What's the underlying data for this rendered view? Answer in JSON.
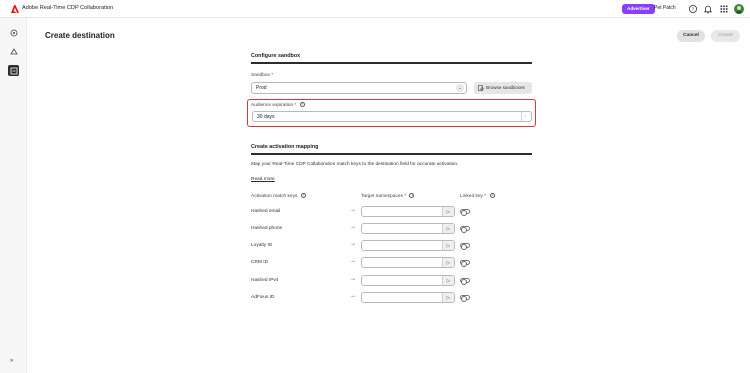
{
  "header": {
    "app_title": "Adobe Real-Time CDP Collaboration",
    "role_badge": "Advertiser",
    "org_name": "Pet Patch",
    "icons": [
      "help-icon",
      "bell-icon",
      "apps-grid-icon"
    ],
    "brand_color": "#eb1000",
    "badge_color": "#8a3ffc"
  },
  "rail": {
    "items": [
      "home-icon",
      "audiences-icon",
      "destinations-icon"
    ],
    "collapse_icon": "expand-chevrons-icon"
  },
  "page": {
    "title": "Create destination",
    "cancel_label": "Cancel",
    "create_label": "Create"
  },
  "sandbox_section": {
    "title": "Configure sandbox",
    "sandbox_label": "Sandbox",
    "required_mark": "*",
    "sandbox_value": "Prod",
    "browse_label": "Browse sandboxes",
    "expiration_label": "Audience expiration",
    "expiration_value": "30 days",
    "highlight_color": "#d7373f"
  },
  "mapping_section": {
    "title": "Create activation mapping",
    "description": "Map your Real-Time CDP Collaboration match keys to the destination field for accurate activation.",
    "read_more": "Read more",
    "col_match_keys": "Activation match keys",
    "col_namespaces": "Target namespaces",
    "col_linked_key": "Linked key",
    "required_mark": "*",
    "rows": [
      {
        "label": "Hashed email",
        "namespace": "",
        "linked": false
      },
      {
        "label": "Hashed phone",
        "namespace": "",
        "linked": false
      },
      {
        "label": "Loyalty ID",
        "namespace": "",
        "linked": false
      },
      {
        "label": "CRM ID",
        "namespace": "",
        "linked": false
      },
      {
        "label": "Hashed IPv4",
        "namespace": "",
        "linked": false
      },
      {
        "label": "AdFixus ID",
        "namespace": "",
        "linked": false
      }
    ]
  }
}
